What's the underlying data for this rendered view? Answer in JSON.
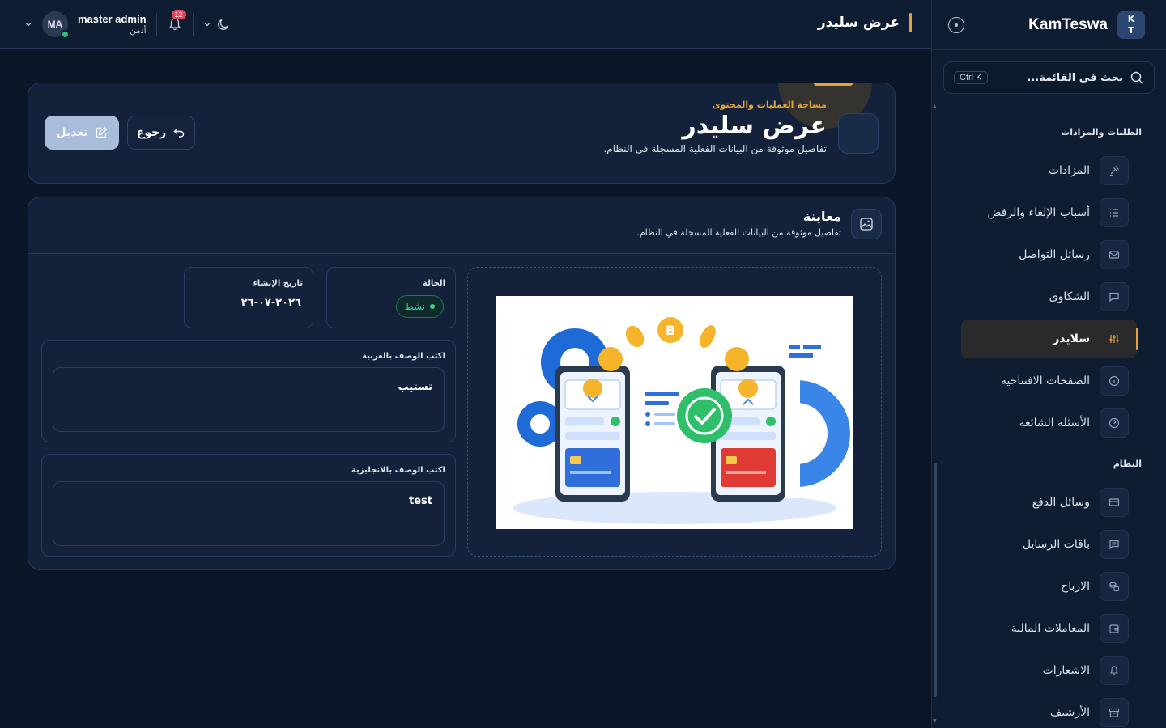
{
  "brand": {
    "name": "KamTeswa",
    "logo_top": "K",
    "logo_bottom": "T"
  },
  "search": {
    "placeholder": "بحث في القائمة...",
    "shortcut": "Ctrl K"
  },
  "sidebar": {
    "sections": [
      {
        "title": "الطلبات والمزادات",
        "items": [
          {
            "label": "المزادات",
            "icon": "gavel-icon"
          },
          {
            "label": "أسباب الإلغاء والرفض",
            "icon": "list-icon"
          },
          {
            "label": "رسائل التواصل",
            "icon": "mail-icon"
          },
          {
            "label": "الشكاوى",
            "icon": "chat-icon"
          },
          {
            "label": "سلايدر",
            "icon": "sliders-icon",
            "active": true
          },
          {
            "label": "الصفحات الافتتاحية",
            "icon": "info-icon"
          },
          {
            "label": "الأسئلة الشائعة",
            "icon": "help-icon"
          }
        ]
      },
      {
        "title": "النظام",
        "items": [
          {
            "label": "وسائل الدفع",
            "icon": "card-icon"
          },
          {
            "label": "باقات الرسايل",
            "icon": "message-icon"
          },
          {
            "label": "الارباح",
            "icon": "coins-icon"
          },
          {
            "label": "المعاملات المالية",
            "icon": "wallet-icon"
          },
          {
            "label": "الاشعارات",
            "icon": "bell-icon"
          },
          {
            "label": "الأرشيف",
            "icon": "archive-icon"
          }
        ]
      }
    ]
  },
  "topbar": {
    "title": "عرض سليدر",
    "user_name": "master admin",
    "user_role": "أدمن",
    "avatar_initials": "MA",
    "notification_count": "12"
  },
  "header": {
    "eyebrow": "مساحة العمليات والمحتوى",
    "title": "عرض سليدر",
    "subtitle": "تفاصيل موثوقة من البيانات الفعلية المسجلة في النظام.",
    "edit_label": "تعديل",
    "back_label": "رجوع"
  },
  "preview": {
    "title": "معاينة",
    "subtitle": "تفاصيل موثوقة من البيانات الفعلية المسجلة في النظام.",
    "status_label": "الحالة",
    "status_value": "نشط",
    "created_label": "تاريخ الإنشاء",
    "created_value": "٢٠٢٦-٠٧-٢٦",
    "desc_ar_label": "اكتب الوصف بالعربية",
    "desc_ar_value": "تستيب",
    "desc_en_label": "اكتب الوصف بالانجليزية",
    "desc_en_value": "test"
  },
  "colors": {
    "accent": "#e4a33a",
    "success": "#3fd08a",
    "primary_button": "#a9bcd9"
  }
}
